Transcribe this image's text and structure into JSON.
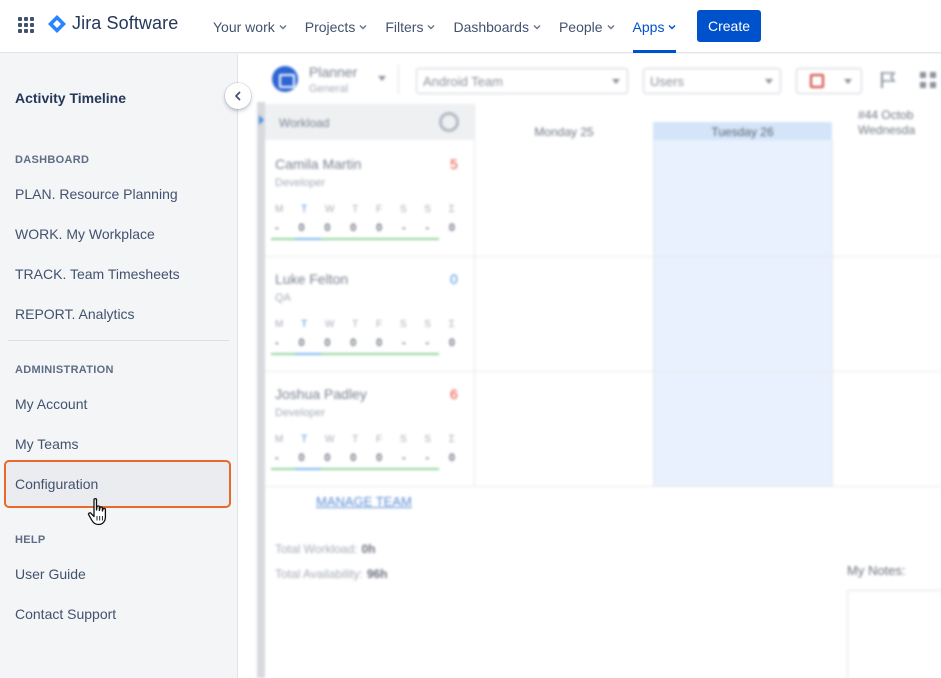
{
  "topnav": {
    "app_name": "Jira Software",
    "brand_color": "#0052cc",
    "items": [
      {
        "label": "Your work",
        "active": false
      },
      {
        "label": "Projects",
        "active": false
      },
      {
        "label": "Filters",
        "active": false
      },
      {
        "label": "Dashboards",
        "active": false
      },
      {
        "label": "People",
        "active": false
      },
      {
        "label": "Apps",
        "active": true
      }
    ],
    "create_label": "Create"
  },
  "sidebar": {
    "title": "Activity Timeline",
    "sections": [
      {
        "heading": "DASHBOARD",
        "items": [
          "PLAN. Resource Planning",
          "WORK. My Workplace",
          "TRACK. Team Timesheets",
          "REPORT. Analytics"
        ]
      },
      {
        "heading": "ADMINISTRATION",
        "items": [
          "My Account",
          "My Teams",
          "Configuration"
        ]
      },
      {
        "heading": "HELP",
        "items": [
          "User Guide",
          "Contact Support"
        ]
      }
    ],
    "highlighted_item": "Configuration",
    "highlight_color": "#e8682d"
  },
  "main": {
    "planner": {
      "title": "Planner",
      "subtitle": "General"
    },
    "team_select": "Android Team",
    "users_select": "Users",
    "workload_label": "Workload",
    "days": [
      {
        "label": "Monday 25",
        "today": false
      },
      {
        "label": "Tuesday 26",
        "today": true
      },
      {
        "label": "#44 Octob\nWednesda",
        "today": false
      }
    ],
    "weekday_letters": [
      "M",
      "T",
      "W",
      "T",
      "F",
      "S",
      "S",
      "Σ"
    ],
    "people": [
      {
        "name": "Camila Martin",
        "role": "Developer",
        "count": "5",
        "count_color": "#e5493a",
        "values": [
          "-",
          "0",
          "0",
          "0",
          "0",
          "-",
          "-",
          "0"
        ]
      },
      {
        "name": "Luke Felton",
        "role": "QA",
        "count": "0",
        "count_color": "#4a90e2",
        "values": [
          "-",
          "0",
          "0",
          "0",
          "0",
          "-",
          "-",
          "0"
        ]
      },
      {
        "name": "Joshua Padley",
        "role": "Developer",
        "count": "6",
        "count_color": "#e5493a",
        "values": [
          "-",
          "0",
          "0",
          "0",
          "0",
          "-",
          "-",
          "0"
        ]
      }
    ],
    "manage_team": "MANAGE TEAM",
    "total_workload_label": "Total Workload:",
    "total_workload_value": "0h",
    "total_availability_label": "Total Availability:",
    "total_availability_value": "96h",
    "notes_label": "My Notes:"
  }
}
